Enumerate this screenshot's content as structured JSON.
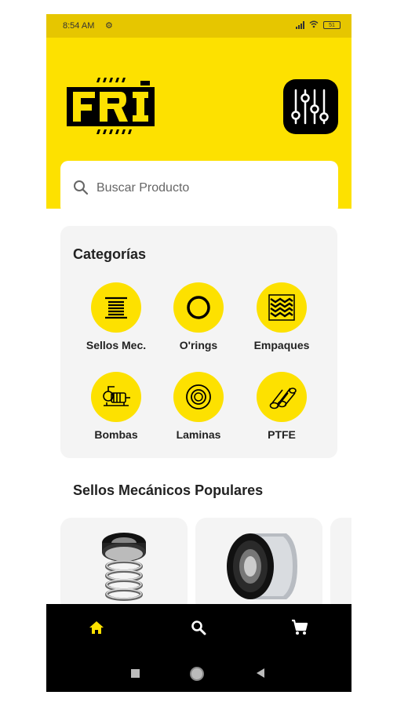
{
  "status_bar": {
    "time": "8:54 AM",
    "battery": "51",
    "icons": [
      "settings-icon",
      "signal-icon",
      "wifi-icon",
      "battery-icon"
    ]
  },
  "header": {
    "logo_text": "FRI",
    "filter_icon": "sliders-icon"
  },
  "search": {
    "placeholder": "Buscar Producto",
    "icon": "search-icon"
  },
  "categories": {
    "title": "Categorías",
    "items": [
      {
        "label": "Sellos Mec.",
        "icon": "lines-icon"
      },
      {
        "label": "O'rings",
        "icon": "ring-icon"
      },
      {
        "label": "Empaques",
        "icon": "weave-icon"
      },
      {
        "label": "Bombas",
        "icon": "pump-icon"
      },
      {
        "label": "Laminas",
        "icon": "washer-icon"
      },
      {
        "label": "PTFE",
        "icon": "tubes-icon"
      }
    ]
  },
  "popular": {
    "title": "Sellos Mecánicos Populares",
    "products": [
      {
        "icon": "spring-seal-image"
      },
      {
        "icon": "cartridge-seal-image"
      }
    ]
  },
  "bottom_nav": {
    "items": [
      {
        "icon": "home-icon",
        "active": true
      },
      {
        "icon": "search-icon",
        "active": false
      },
      {
        "icon": "cart-icon",
        "active": false
      }
    ],
    "active_color": "#fde100"
  },
  "system_nav": [
    "recents-icon",
    "home-circle-icon",
    "back-icon"
  ],
  "colors": {
    "brand_yellow": "#fde100",
    "dark": "#000000",
    "panel": "#f4f4f4"
  }
}
